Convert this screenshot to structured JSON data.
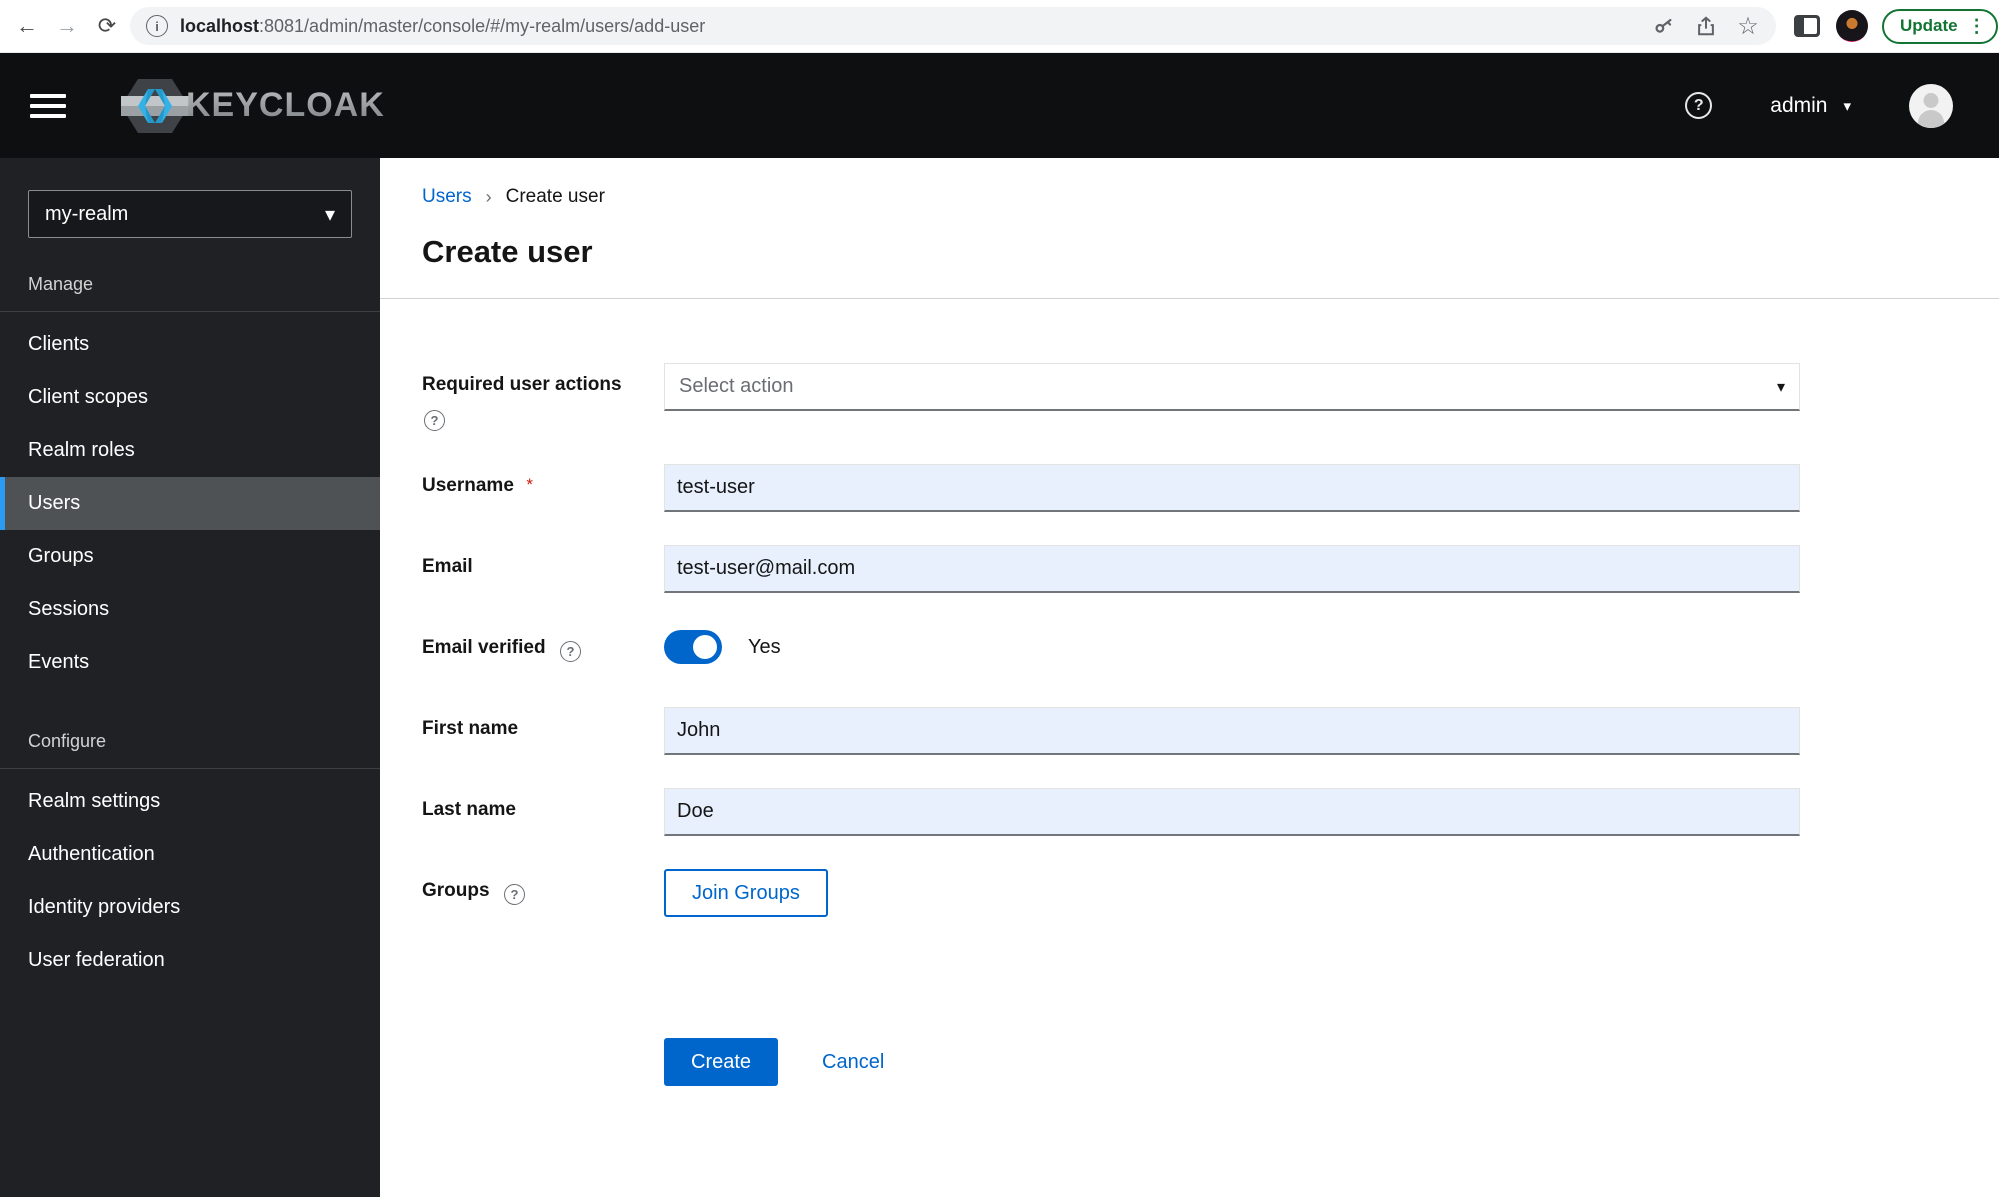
{
  "browser": {
    "url_host": "localhost",
    "url_rest": ":8081/admin/master/console/#/my-realm/users/add-user",
    "update_label": "Update",
    "icons": {
      "back": "←",
      "forward": "→",
      "reload": "⟳",
      "info": "i",
      "star": "☆",
      "menu_dots": "⋮"
    }
  },
  "header": {
    "brand": "KEYCLOAK",
    "help_glyph": "?",
    "username": "admin",
    "caret_glyph": "▾"
  },
  "sidebar": {
    "realm": "my-realm",
    "caret_glyph": "▾",
    "groups": [
      {
        "label": "Manage",
        "items": [
          {
            "label": "Clients"
          },
          {
            "label": "Client scopes"
          },
          {
            "label": "Realm roles"
          },
          {
            "label": "Users",
            "active": true
          },
          {
            "label": "Groups"
          },
          {
            "label": "Sessions"
          },
          {
            "label": "Events"
          }
        ]
      },
      {
        "label": "Configure",
        "items": [
          {
            "label": "Realm settings"
          },
          {
            "label": "Authentication"
          },
          {
            "label": "Identity providers"
          },
          {
            "label": "User federation"
          }
        ]
      }
    ]
  },
  "breadcrumb": {
    "items": [
      {
        "label": "Users"
      },
      {
        "label": "Create user"
      }
    ],
    "separator": "›"
  },
  "page": {
    "title": "Create user"
  },
  "form": {
    "required_actions": {
      "label": "Required user actions",
      "placeholder": "Select action",
      "help_glyph": "?",
      "caret_glyph": "▾"
    },
    "username": {
      "label": "Username",
      "required_mark": "*",
      "value": "test-user"
    },
    "email": {
      "label": "Email",
      "value": "test-user@mail.com"
    },
    "email_verified": {
      "label": "Email verified",
      "state": "Yes",
      "help_glyph": "?",
      "enabled": true
    },
    "first_name": {
      "label": "First name",
      "value": "John"
    },
    "last_name": {
      "label": "Last name",
      "value": "Doe"
    },
    "groups": {
      "label": "Groups",
      "button_label": "Join Groups",
      "help_glyph": "?"
    }
  },
  "actions": {
    "create": "Create",
    "cancel": "Cancel"
  },
  "colors": {
    "accent": "#0066cc",
    "nav_selected_border": "#2b9af3",
    "autofill_bg": "#e8f0fe",
    "update_green": "#137333",
    "masthead_bg": "#0e0f11",
    "sidebar_bg": "#1f2125"
  }
}
